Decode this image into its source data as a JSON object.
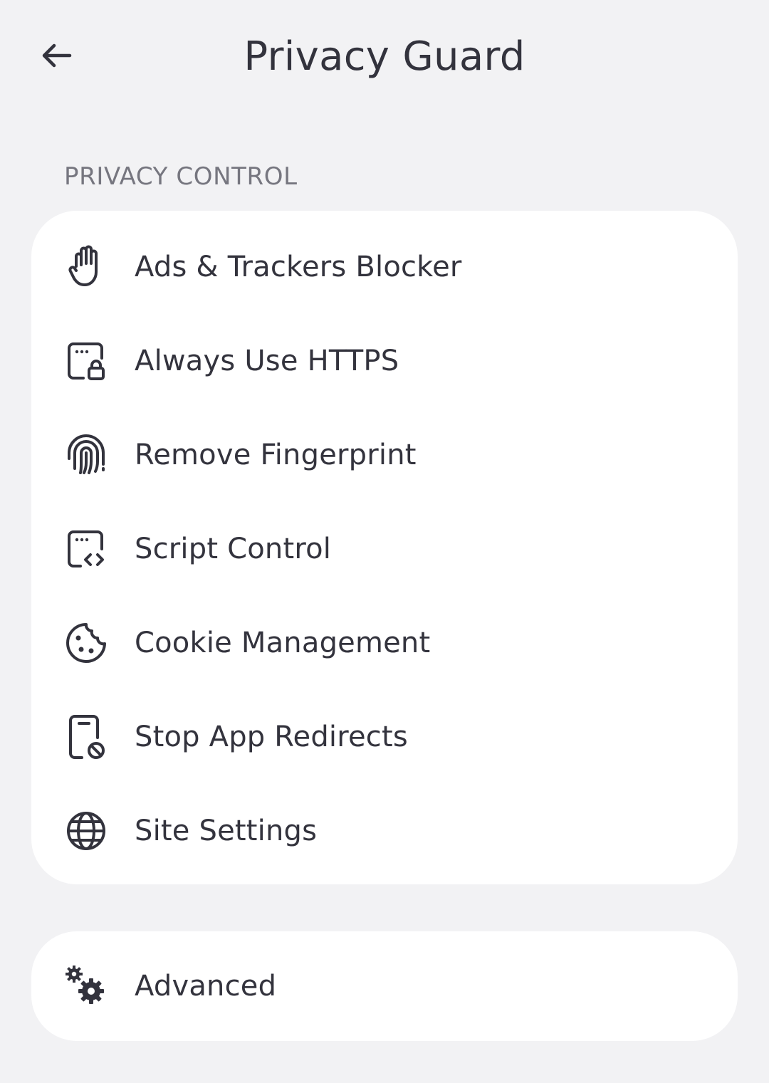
{
  "header": {
    "title": "Privacy Guard",
    "back_icon": "arrow-left-icon"
  },
  "section": {
    "label": "PRIVACY CONTROL"
  },
  "items": [
    {
      "label": "Ads & Trackers Blocker",
      "icon": "hand-stop-icon"
    },
    {
      "label": "Always Use HTTPS",
      "icon": "browser-lock-icon"
    },
    {
      "label": "Remove Fingerprint",
      "icon": "fingerprint-icon"
    },
    {
      "label": "Script Control",
      "icon": "browser-code-icon"
    },
    {
      "label": "Cookie Management",
      "icon": "cookie-icon"
    },
    {
      "label": "Stop App Redirects",
      "icon": "phone-block-icon"
    },
    {
      "label": "Site Settings",
      "icon": "globe-icon"
    }
  ],
  "advanced": {
    "label": "Advanced",
    "icon": "gears-icon"
  },
  "colors": {
    "background": "#f2f2f4",
    "card": "#ffffff",
    "text": "#33333d",
    "section_label": "#76767f"
  }
}
